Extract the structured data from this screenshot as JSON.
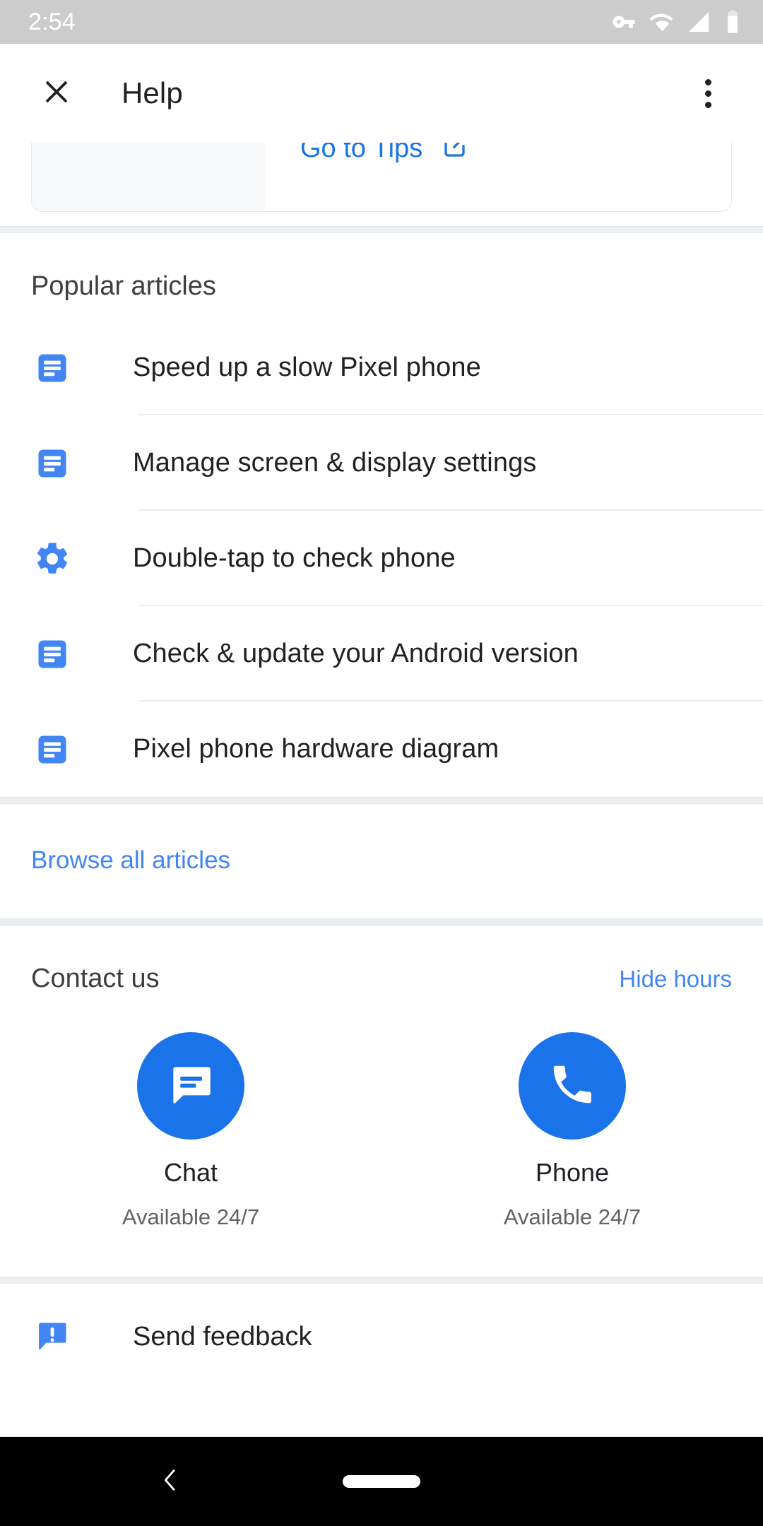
{
  "status_bar": {
    "time": "2:54",
    "icons": [
      "vpn-key-icon",
      "wifi-icon",
      "signal-cellular-icon",
      "battery-icon"
    ]
  },
  "app_bar": {
    "close_icon": "close-icon",
    "title": "Help",
    "overflow_icon": "more-vert-icon"
  },
  "tips_card": {
    "link_label": "Go to Tips",
    "link_icon": "open-in-new-icon"
  },
  "popular_articles": {
    "title": "Popular articles",
    "items": [
      {
        "label": "Speed up a slow Pixel phone",
        "icon": "article-icon"
      },
      {
        "label": "Manage screen & display settings",
        "icon": "article-icon"
      },
      {
        "label": "Double-tap to check phone",
        "icon": "settings-gear-icon"
      },
      {
        "label": "Check & update your Android version",
        "icon": "article-icon"
      },
      {
        "label": "Pixel phone hardware diagram",
        "icon": "article-icon"
      }
    ],
    "browse_all_label": "Browse all articles"
  },
  "contact_us": {
    "title": "Contact us",
    "toggle_label": "Hide hours",
    "options": [
      {
        "name": "Chat",
        "hours": "Available 24/7",
        "icon": "chat-bubble-icon"
      },
      {
        "name": "Phone",
        "hours": "Available 24/7",
        "icon": "phone-call-icon"
      }
    ]
  },
  "feedback": {
    "label": "Send feedback",
    "icon": "feedback-icon"
  },
  "nav_bar": {
    "back_icon": "back-chevron-icon",
    "home_icon": "home-pill-icon"
  },
  "colors": {
    "accent_blue": "#1a73e8",
    "link_blue": "#4285f4",
    "icon_blue": "#4285f4",
    "text_primary": "#202124",
    "text_secondary": "#5f6368",
    "status_bar_bg": "#cccccc",
    "nav_bar_bg": "#000000",
    "divider": "#eceeef"
  }
}
